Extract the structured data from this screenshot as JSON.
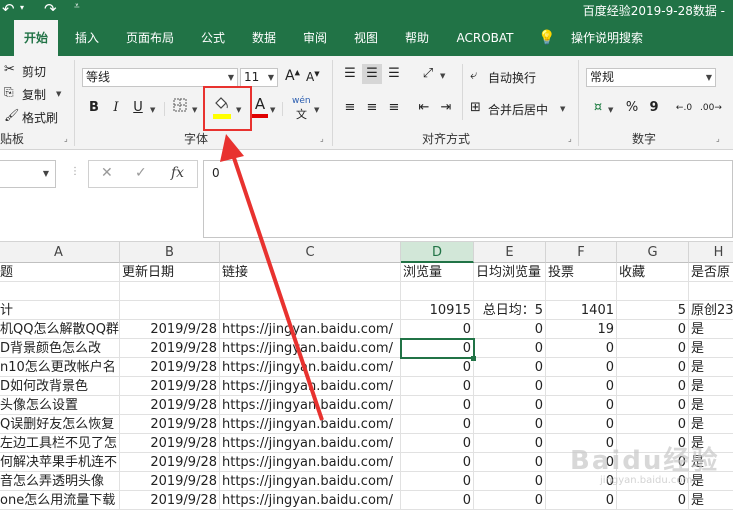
{
  "titlebar": {
    "title": "百度经验2019-9-28数据 -",
    "icons": [
      "undo-icon",
      "redo-icon",
      "quick-access-dropdown-icon"
    ]
  },
  "tabs": [
    {
      "label": "开始",
      "active": true
    },
    {
      "label": "插入"
    },
    {
      "label": "页面布局"
    },
    {
      "label": "公式"
    },
    {
      "label": "数据"
    },
    {
      "label": "审阅"
    },
    {
      "label": "视图"
    },
    {
      "label": "帮助"
    },
    {
      "label": "ACROBAT"
    },
    {
      "label": "操作说明搜索"
    }
  ],
  "ribbon": {
    "clipboard": {
      "cut": "剪切",
      "copy": "复制",
      "format_painter": "格式刷",
      "label": "贴板"
    },
    "font": {
      "font_name": "等线",
      "font_size": "11",
      "bold": "B",
      "italic": "I",
      "underline": "U",
      "font_color_letter": "A",
      "phonetic": "wén",
      "label": "字体",
      "fill_color": "#ffff00",
      "font_color": "#e00000"
    },
    "alignment": {
      "wrap_text": "自动换行",
      "merge_center": "合并后居中",
      "label": "对齐方式"
    },
    "number": {
      "format": "常规",
      "percent": "%",
      "comma": "9",
      "label": "数字"
    }
  },
  "formula_bar": {
    "name_box": "",
    "cancel": "✕",
    "enter": "✓",
    "fx": "fx",
    "content": "0"
  },
  "sheet": {
    "columns": [
      "A",
      "B",
      "C",
      "D",
      "E",
      "F",
      "G",
      "H"
    ],
    "selected_column": "D",
    "header_row": [
      "题",
      "更新日期",
      "链接",
      "浏览量",
      "日均浏览量",
      "投票",
      "收藏",
      "是否原"
    ],
    "blank_row": [
      "",
      "",
      "",
      "",
      "",
      "",
      "",
      ""
    ],
    "total_row": [
      "计",
      "",
      "",
      "10915",
      "总日均：5",
      "1401",
      "5",
      "原创23"
    ],
    "rows": [
      [
        "机QQ怎么解散QQ群",
        "2019/9/28",
        "https://jingyan.baidu.com/",
        "0",
        "0",
        "19",
        "0",
        "是"
      ],
      [
        "D背景颜色怎么改",
        "2019/9/28",
        "https://jingyan.baidu.com/",
        "0",
        "0",
        "0",
        "0",
        "是"
      ],
      [
        "n10怎么更改帐户名",
        "2019/9/28",
        "https://jingyan.baidu.com/",
        "0",
        "0",
        "0",
        "0",
        "是"
      ],
      [
        "D如何改背景色",
        "2019/9/28",
        "https://jingyan.baidu.com/",
        "0",
        "0",
        "0",
        "0",
        "是"
      ],
      [
        "头像怎么设置",
        "2019/9/28",
        "https://jingyan.baidu.com/",
        "0",
        "0",
        "0",
        "0",
        "是"
      ],
      [
        "Q误删好友怎么恢复",
        "2019/9/28",
        "https://jingyan.baidu.com/",
        "0",
        "0",
        "0",
        "0",
        "是"
      ],
      [
        "左边工具栏不见了怎",
        "2019/9/28",
        "https://jingyan.baidu.com/",
        "0",
        "0",
        "0",
        "0",
        "是"
      ],
      [
        "何解决苹果手机连不",
        "2019/9/28",
        "https://jingyan.baidu.com/",
        "0",
        "0",
        "0",
        "0",
        "是"
      ],
      [
        "音怎么弄透明头像",
        "2019/9/28",
        "https://jingyan.baidu.com/",
        "0",
        "0",
        "0",
        "0",
        "是"
      ],
      [
        "one怎么用流量下载",
        "2019/9/28",
        "https://jingyan.baidu.com/",
        "0",
        "0",
        "0",
        "0",
        "是"
      ]
    ]
  },
  "watermark": {
    "text": "Baidu经验",
    "sub": "jingyan.baidu.com"
  },
  "annotation_color": "#e8322f"
}
